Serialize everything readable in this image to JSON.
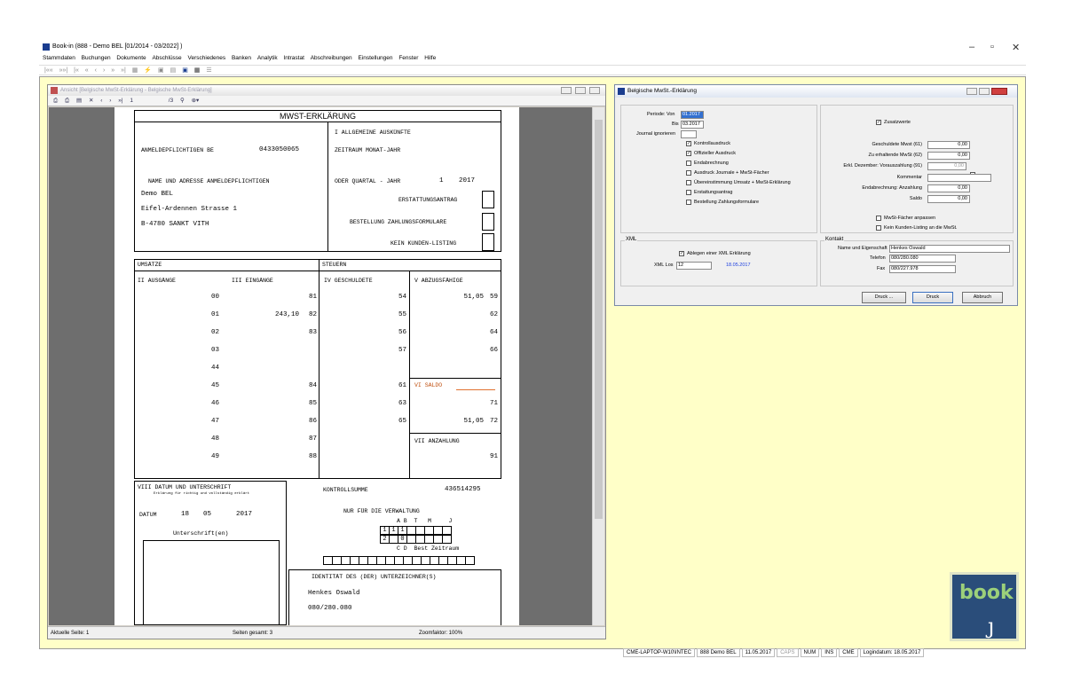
{
  "window": {
    "title": "Book-in (888 - Demo BEL [01/2014 - 03/2022] )",
    "controls": [
      "–",
      "▫",
      "✕"
    ]
  },
  "menu": [
    "Stammdaten",
    "Buchungen",
    "Dokumente",
    "Abschlüsse",
    "Verschiedenes",
    "Banken",
    "Analytik",
    "Intrastat",
    "Abschreibungen",
    "Einstellungen",
    "Fenster",
    "Hilfe"
  ],
  "toolbar": [
    "|««",
    "»»|",
    "|«",
    "«",
    "‹",
    "›",
    "»",
    "»|",
    "▦",
    "⚡",
    "▣",
    "▤",
    "▣",
    "▦",
    "☰"
  ],
  "preview": {
    "title": "Ansicht [Belgische MwSt-Erklärung - Belgische MwSt-Erklärung]",
    "page_input": "1",
    "page_of": "/3",
    "status": {
      "current": "Aktuelle Seite: 1",
      "total": "Seiten gesamt: 3",
      "zoom": "Zoomfaktor: 100%"
    }
  },
  "form": {
    "title": "MWST-ERKLÄRUNG",
    "decl_label": "ANMELDEPFLICHTIGEN BE",
    "vat_number": "0433050065",
    "section1": "I   ALLGEMEINE AUSKÜNFTE",
    "period_label": "ZEITRAUM MONAT-JAHR",
    "name_addr_label": "NAME UND ADRESSE ANMELDEPFLICHTIGEN",
    "quarter_label": "ODER QUARTAL - JAHR",
    "quarter": "1",
    "year": "2017",
    "company": "Demo BEL",
    "street": "Eifel-Ardennen Strasse 1",
    "city": "B-4780 SANKT VITH",
    "refund": "ERSTATTUNGSANTRAG",
    "order_forms": "BESTELLUNG ZAHLUNGSFORMULARE",
    "no_listing": "KEIN KUNDEN-LISTING",
    "umsaetze": "UMSÄTZE",
    "steuern": "STEUERN",
    "col2": "II AUSGÄNGE",
    "col3": "III EINGÄNGE",
    "col4": "IV GESCHULDETE",
    "col5": "V ABZUGSFÄHIGE",
    "rows": [
      {
        "a": "00",
        "b_val": "",
        "b": "81",
        "c": "54",
        "d_val": "51,05",
        "d": "59"
      },
      {
        "a": "01",
        "b_val": "243,10",
        "b": "82",
        "c": "55",
        "d_val": "",
        "d": "62"
      },
      {
        "a": "02",
        "b_val": "",
        "b": "83",
        "c": "56",
        "d_val": "",
        "d": "64"
      },
      {
        "a": "03",
        "b_val": "",
        "b": "",
        "c": "57",
        "d_val": "",
        "d": "66"
      },
      {
        "a": "44",
        "b_val": "",
        "b": "",
        "c": "",
        "d_val": "",
        "d": ""
      },
      {
        "a": "45",
        "b_val": "",
        "b": "84",
        "c": "61",
        "d_val": "",
        "d": ""
      },
      {
        "a": "46",
        "b_val": "",
        "b": "85",
        "c": "63",
        "d_val": "",
        "d": "71"
      },
      {
        "a": "47",
        "b_val": "",
        "b": "86",
        "c": "65",
        "d_val": "51,05",
        "d": "72"
      },
      {
        "a": "48",
        "b_val": "",
        "b": "87",
        "c": "",
        "d_val": "",
        "d": ""
      },
      {
        "a": "49",
        "b_val": "",
        "b": "88",
        "c": "",
        "d_val": "",
        "d": "91"
      }
    ],
    "saldo": "VI SALDO",
    "anzahlung": "VII ANZAHLUNG",
    "sig_title": "VIII DATUM UND UNTERSCHRIFT",
    "sig_sub": "Erklärung für richtig und vollständig erklärt",
    "datum_label": "DATUM",
    "datum_d": "18",
    "datum_m": "05",
    "datum_y": "2017",
    "unterschrift": "Unterschrift(en)",
    "checksum_label": "KONTROLLSUMME",
    "checksum": "436514295",
    "admin": "NUR FÜR DIE VERWALTUNG",
    "admin_cols": "A B  T   M     J",
    "admin_row1": [
      "1",
      "1",
      "1",
      "",
      "",
      "",
      "",
      ""
    ],
    "admin_row2": [
      "2",
      "",
      "0",
      "",
      "",
      "",
      "",
      ""
    ],
    "admin_foot": "C D  Best Zeitraum",
    "ident": "IDENTITÄT DES (DER) UNTERZEICHNER(S)",
    "signer": "Henkes Oswald",
    "signer_phone": "080/280.080"
  },
  "dialog": {
    "title": "Belgische MwSt.-Erklärung",
    "periode_von_label": "Periode: Von",
    "periode_von": "01.2017",
    "bis_label": "Bis",
    "bis": "03.2017",
    "journal_label": "Journal ignorieren",
    "checks_left": [
      {
        "label": "Kontrollausdruck",
        "checked": true
      },
      {
        "label": "Offizieller Ausdruck",
        "checked": true
      },
      {
        "label": "Endabrechnung",
        "checked": false
      },
      {
        "label": "Ausdruck Journale + MwSt-Fächer",
        "checked": false
      },
      {
        "label": "Übereinstimmung Umsatz + MwSt-Erklärung",
        "checked": false
      },
      {
        "label": "Erstattungsantrag",
        "checked": false
      },
      {
        "label": "Bestellung Zahlungsformulare",
        "checked": false
      }
    ],
    "zusatzwerte": "Zusatzwerte",
    "right_fields": [
      {
        "label": "Geschuldete Mwst (61)",
        "value": "0,00"
      },
      {
        "label": "Zu erhaltende MwSt (62)",
        "value": "0,00"
      },
      {
        "label": "Erkl. Dezember: Vorauszahlung (91)",
        "value": "0,00"
      },
      {
        "label": "Kommentar",
        "value": ""
      },
      {
        "label": "Endabrechnung: Anzahlung",
        "value": "0,00"
      },
      {
        "label": "Saldo",
        "value": "0,00"
      }
    ],
    "mwst_anpassen": "MwSt-Fächer anpassen",
    "kein_listing": "Kein Kunden-Listing an die MwSt.",
    "xml_group": "XML",
    "xml_check": "Ablegen einer XML Erklärung",
    "xml_los_label": "XML Los",
    "xml_los": "12",
    "xml_date": "18.05.2017",
    "kontakt_group": "Kontakt",
    "name_label": "Name und Eigenschaft",
    "name": "Henkes Oswald",
    "tel_label": "Telefon",
    "tel": "080/280.080",
    "fax_label": "Fax",
    "fax": "080/227.978",
    "btn_druck_dots": "Druck ...",
    "btn_druck": "Druck",
    "btn_abbruch": "Abbruch"
  },
  "statusbar": [
    "CME-LAPTOP-W10\\INTEC",
    "888 Demo BEL",
    "11.05.2017",
    "CAPS",
    "NUM",
    "INS",
    "CME",
    "Logindatum: 18.05.2017"
  ],
  "logo_text": "book",
  "colors": {
    "mdi_bg": "#ffffc8",
    "accent": "#1a3d8f",
    "saldo_line": "#e07030",
    "date_blue": "#1a3ddf"
  }
}
